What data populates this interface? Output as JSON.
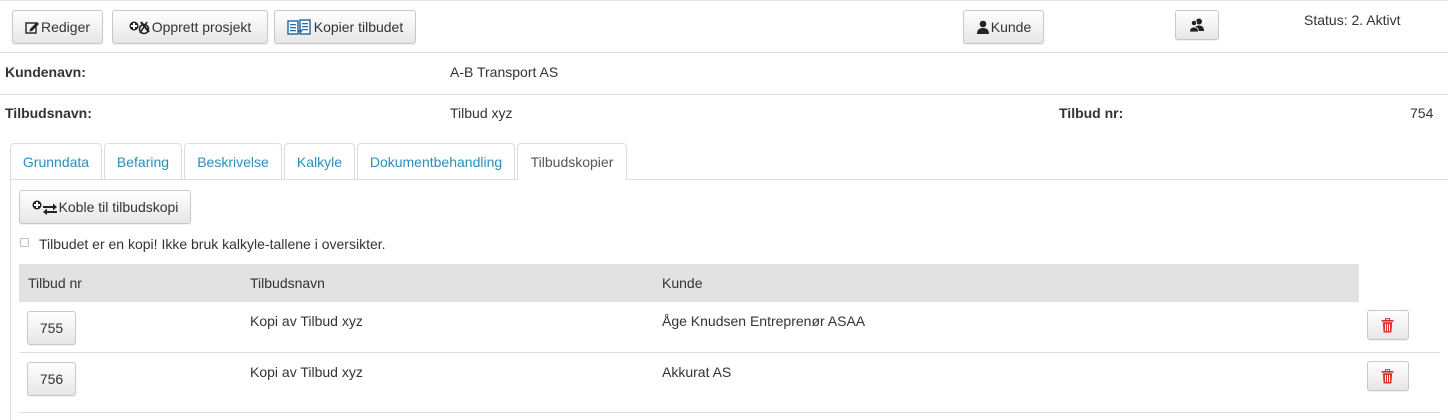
{
  "toolbar": {
    "edit_label": "Rediger",
    "create_project_label": "Opprett prosjekt",
    "copy_offer_label": "Kopier tilbudet",
    "customer_label": "Kunde",
    "status_text": "Status: 2. Aktivt"
  },
  "info": {
    "customer_name_label": "Kundenavn:",
    "customer_name_value": "A-B Transport AS",
    "offer_name_label": "Tilbudsnavn:",
    "offer_name_value": "Tilbud xyz",
    "offer_no_label": "Tilbud nr:",
    "offer_no_value": "754"
  },
  "tabs": [
    {
      "label": "Grunndata"
    },
    {
      "label": "Befaring"
    },
    {
      "label": "Beskrivelse"
    },
    {
      "label": "Kalkyle"
    },
    {
      "label": "Dokumentbehandling"
    },
    {
      "label": "Tilbudskopier"
    }
  ],
  "active_tab": "Tilbudskopier",
  "copies": {
    "link_button_label": "Koble til tilbudskopi",
    "is_copy_checkbox_label": "Tilbudet er en kopi! Ikke bruk kalkyle-tallene i oversikter.",
    "is_copy_checked": false,
    "columns": [
      "Tilbud nr",
      "Tilbudsnavn",
      "Kunde"
    ],
    "rows": [
      {
        "offer_no": "755",
        "offer_name": "Kopi av Tilbud xyz",
        "customer": "Åge Knudsen Entreprenør ASAA"
      },
      {
        "offer_no": "756",
        "offer_name": "Kopi av Tilbud xyz",
        "customer": "Akkurat AS"
      }
    ]
  },
  "icons": {
    "edit": "pencil-square-icon",
    "create_project": "plus-tools-icon",
    "copy_offer": "copy-document-icon",
    "customer": "user-icon",
    "contacts": "users-icon",
    "link": "plus-exchange-icon",
    "delete": "trash-icon"
  },
  "colors": {
    "tab_link": "#2a8fbd",
    "table_header_bg": "#e2e2e2",
    "delete_icon": "#d9332b"
  }
}
